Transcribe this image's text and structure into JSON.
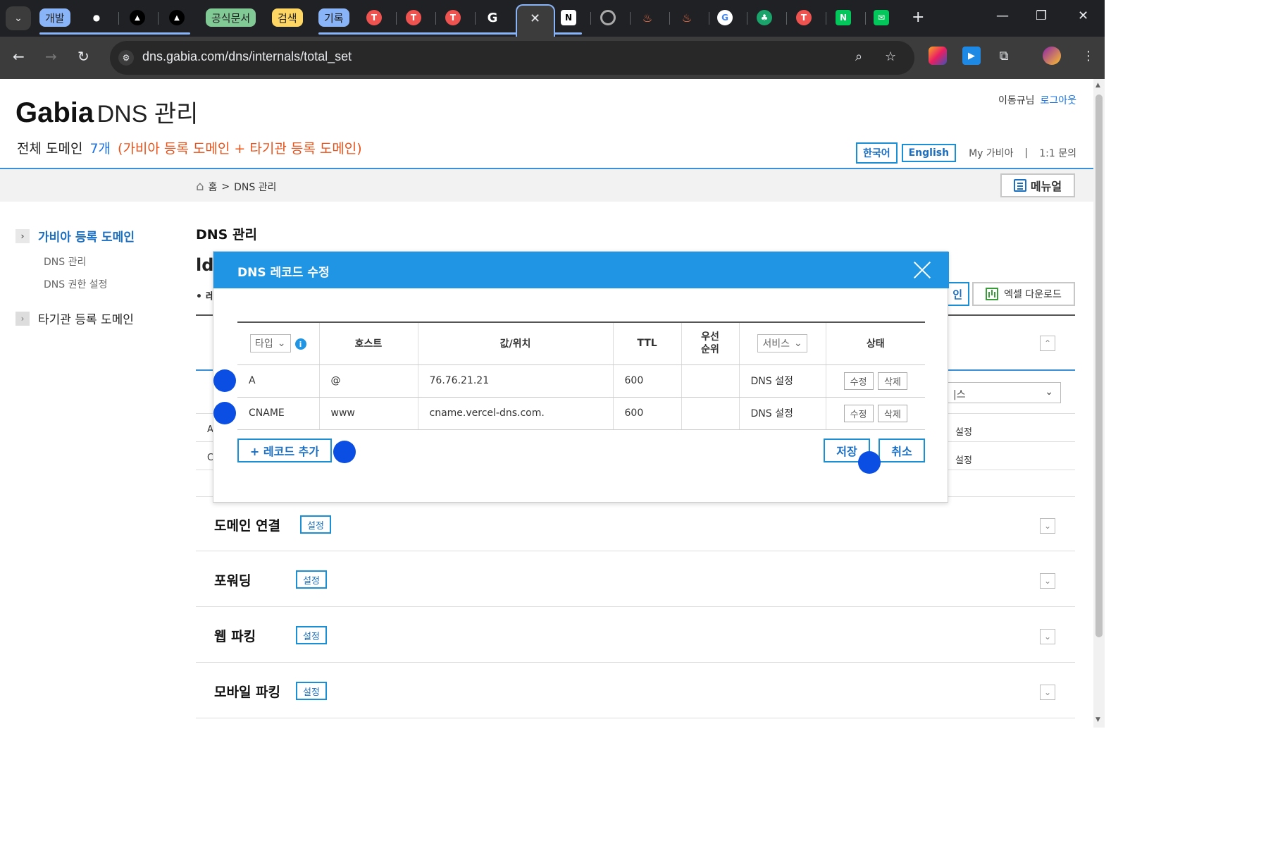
{
  "browser": {
    "tab_groups": [
      {
        "label": "개발",
        "color": "#8ab4f8"
      },
      {
        "label": "공식문서",
        "color": "#81c995"
      },
      {
        "label": "검색",
        "color": "#fdd663"
      },
      {
        "label": "기록",
        "color": "#8ab4f8"
      }
    ],
    "new_tab_symbol": "+",
    "url": "dns.gabia.com/dns/internals/total_set"
  },
  "header": {
    "brand_bold": "Gabia",
    "brand_rest": "DNS 관리",
    "summary_label": "전체 도메인",
    "summary_count": "7개",
    "summary_detail": "(가비아 등록 도메인 + 타기관 등록 도메인)",
    "user_name": "이동규님",
    "logout": "로그아웃",
    "lang_ko": "한국어",
    "lang_en": "English",
    "my_gabia": "My 가비아",
    "separator": "|",
    "inquiry": "1:1 문의"
  },
  "breadcrumb": {
    "home": "홈",
    "sep": ">",
    "current": "DNS 관리"
  },
  "manual_button": "메뉴얼",
  "sidebar": {
    "groups": [
      {
        "label": "가비아 등록 도메인",
        "items": [
          "DNS 관리",
          "DNS 권한 설정"
        ]
      },
      {
        "label": "타기관 등록 도메인",
        "items": []
      }
    ]
  },
  "content": {
    "title": "DNS 관리",
    "behind_heading": "ld",
    "behind_sub": "• 레",
    "behind_button": "인",
    "excel_button": "엑셀 다운로드",
    "behind_select": "|스",
    "behind_row1_left": "A",
    "behind_row2_left": "C",
    "behind_row1_right": "설정",
    "behind_row2_right": "설정"
  },
  "sections": [
    {
      "title": "도메인 연결",
      "button": "설정"
    },
    {
      "title": "포워딩",
      "button": "설정"
    },
    {
      "title": "웹 파킹",
      "button": "설정"
    },
    {
      "title": "모바일 파킹",
      "button": "설정"
    }
  ],
  "modal": {
    "title": "DNS 레코드 수정",
    "columns": {
      "type": "타입",
      "host": "호스트",
      "value": "값/위치",
      "ttl": "TTL",
      "priority": "우선\n순위",
      "service": "서비스",
      "status": "상태"
    },
    "records": [
      {
        "type": "A",
        "host": "@",
        "value": "76.76.21.21",
        "ttl": "600",
        "priority": "",
        "service": "DNS 설정",
        "edit": "수정",
        "delete": "삭제"
      },
      {
        "type": "CNAME",
        "host": "www",
        "value": "cname.vercel-dns.com.",
        "ttl": "600",
        "priority": "",
        "service": "DNS 설정",
        "edit": "수정",
        "delete": "삭제"
      }
    ],
    "add_button": "+ 레코드 추가",
    "save_button": "저장",
    "cancel_button": "취소"
  },
  "colors": {
    "accent": "#1f95e3",
    "link": "#1a73e8",
    "orange": "#e8531b",
    "marker": "#0a4ee4"
  }
}
